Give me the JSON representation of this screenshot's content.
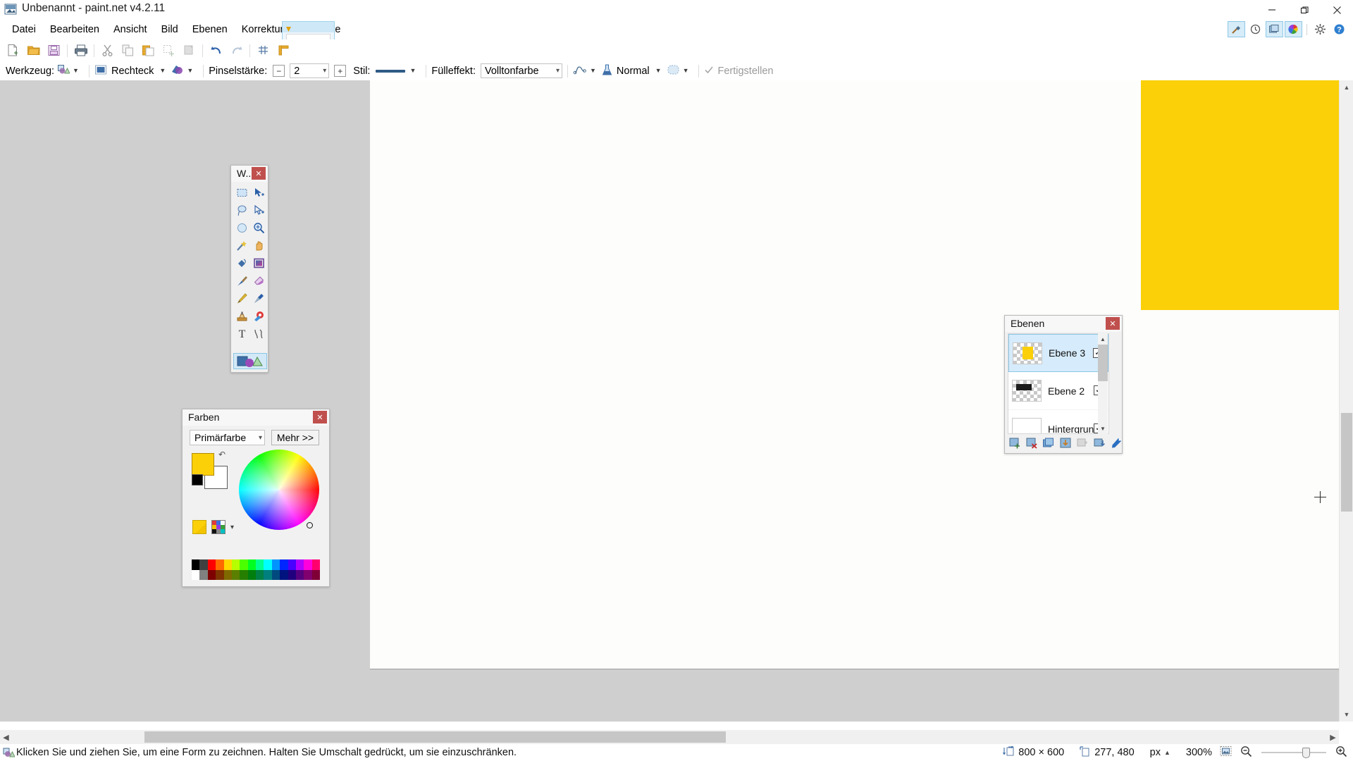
{
  "window": {
    "title": "Unbenannt - paint.net v4.2.11",
    "app_icon": "paintnet-app-icon",
    "controls": {
      "minimize": "minimize-icon",
      "restore": "restore-icon",
      "close": "close-icon"
    }
  },
  "menubar": {
    "items": [
      {
        "label": "Datei"
      },
      {
        "label": "Bearbeiten"
      },
      {
        "label": "Ansicht"
      },
      {
        "label": "Bild"
      },
      {
        "label": "Ebenen"
      },
      {
        "label": "Korrekturen"
      },
      {
        "label": "Effekte"
      }
    ]
  },
  "document_tab": {
    "title_hint": "Unbenannt",
    "thumbnail": "canvas-thumbnail"
  },
  "utility_bar": {
    "buttons": [
      {
        "name": "tools-window-toggle",
        "icon": "hammer-icon",
        "active": true
      },
      {
        "name": "history-window-toggle",
        "icon": "clock-history-icon",
        "active": false
      },
      {
        "name": "layers-window-toggle",
        "icon": "layers-stack-icon",
        "active": true
      },
      {
        "name": "colors-window-toggle",
        "icon": "color-wheel-icon",
        "active": true
      },
      {
        "name": "settings-button",
        "icon": "gear-icon",
        "active": false
      },
      {
        "name": "help-button",
        "icon": "question-circle-icon",
        "active": false
      }
    ]
  },
  "main_toolbar": {
    "buttons": [
      {
        "name": "new-button",
        "icon": "new-document-icon"
      },
      {
        "name": "open-button",
        "icon": "open-folder-icon"
      },
      {
        "name": "save-button",
        "icon": "floppy-save-icon"
      },
      {
        "name": "print-button",
        "icon": "printer-icon"
      },
      {
        "name": "cut-button",
        "icon": "scissors-icon"
      },
      {
        "name": "copy-button",
        "icon": "copy-icon"
      },
      {
        "name": "paste-button",
        "icon": "paste-icon"
      },
      {
        "name": "crop-button",
        "icon": "crop-to-selection-icon"
      },
      {
        "name": "deselect-button",
        "icon": "deselect-icon"
      },
      {
        "name": "undo-button",
        "icon": "undo-arrow-icon"
      },
      {
        "name": "redo-button",
        "icon": "redo-arrow-icon"
      },
      {
        "name": "grid-button",
        "icon": "grid-icon"
      },
      {
        "name": "rulers-button",
        "icon": "ruler-icon"
      }
    ]
  },
  "options_bar": {
    "tool_label": "Werkzeug:",
    "tool_icon": "shapes-tool-icon",
    "shape_label": "Rechteck",
    "shape_icon": "rectangle-shape-icon",
    "shape_type_icon": "shape-type-icon",
    "brush_width_label": "Pinselstärke:",
    "brush_width_value": "2",
    "style_label": "Stil:",
    "style_icon": "line-style-icon",
    "fill_label": "Fülleffekt:",
    "fill_value": "Volltonfarbe",
    "antialias_icon": "antialiasing-icon",
    "blend_icon": "blend-flask-icon",
    "blend_value": "Normal",
    "shape_sample_icon": "shape-preview-icon",
    "finish_label": "Fertigstellen",
    "finish_icon": "checkmark-icon"
  },
  "tools_window": {
    "title": "W...",
    "close_icon": "close-icon",
    "tools": [
      {
        "name": "tool-rectangle-select",
        "icon": "rectangle-select-icon"
      },
      {
        "name": "tool-move-selected",
        "icon": "move-selected-icon"
      },
      {
        "name": "tool-lasso-select",
        "icon": "lasso-select-icon"
      },
      {
        "name": "tool-move-selection",
        "icon": "move-selection-icon"
      },
      {
        "name": "tool-ellipse-select",
        "icon": "ellipse-select-icon"
      },
      {
        "name": "tool-zoom",
        "icon": "magnifier-icon"
      },
      {
        "name": "tool-magic-wand",
        "icon": "magic-wand-icon"
      },
      {
        "name": "tool-pan",
        "icon": "hand-pan-icon"
      },
      {
        "name": "tool-paint-bucket",
        "icon": "paint-bucket-icon"
      },
      {
        "name": "tool-gradient",
        "icon": "gradient-icon"
      },
      {
        "name": "tool-paintbrush",
        "icon": "paintbrush-icon"
      },
      {
        "name": "tool-eraser",
        "icon": "eraser-icon"
      },
      {
        "name": "tool-pencil",
        "icon": "pencil-icon"
      },
      {
        "name": "tool-color-picker",
        "icon": "eyedropper-icon"
      },
      {
        "name": "tool-clone-stamp",
        "icon": "clone-stamp-icon"
      },
      {
        "name": "tool-recolor",
        "icon": "recolor-icon"
      },
      {
        "name": "tool-text",
        "icon": "text-t-icon"
      },
      {
        "name": "tool-line-curve",
        "icon": "line-curve-icon"
      }
    ],
    "selected_tool": {
      "name": "tool-shapes",
      "icon": "shapes-icon"
    }
  },
  "colors_window": {
    "title": "Farben",
    "close_icon": "close-icon",
    "mode_value": "Primärfarbe",
    "more_label": "Mehr >>",
    "primary_color": "#fbd009",
    "secondary_color": "#ffffff",
    "reset_color": "#000000",
    "swap_icon": "swap-colors-icon",
    "add_palette_icon": "add-to-palette-icon",
    "palette_menu_icon": "palette-picker-icon",
    "palette_row1": [
      "#000000",
      "#404040",
      "#ff0000",
      "#ff6a00",
      "#ffd800",
      "#b6ff00",
      "#4cff00",
      "#00ff21",
      "#00ff90",
      "#00ffff",
      "#0094ff",
      "#0026ff",
      "#4800ff",
      "#b200ff",
      "#ff00dc",
      "#ff006e"
    ],
    "palette_row2": [
      "#ffffff",
      "#808080",
      "#7f0000",
      "#7f3300",
      "#7f6a00",
      "#5b7f00",
      "#267f00",
      "#007f0e",
      "#007f46",
      "#007f7f",
      "#004a7f",
      "#00137f",
      "#21007f",
      "#57007f",
      "#7f006e",
      "#7f0037"
    ]
  },
  "layers_window": {
    "title": "Ebenen",
    "close_icon": "close-icon",
    "layers": [
      {
        "name": "Ebene 3",
        "visible": true,
        "selected": true,
        "thumb": "yellow-rect-thumb"
      },
      {
        "name": "Ebene 2",
        "visible": true,
        "selected": false,
        "thumb": "black-rect-thumb"
      },
      {
        "name": "Hintergrund",
        "visible": true,
        "selected": false,
        "thumb": "white-bg-thumb"
      }
    ],
    "toolbar": [
      {
        "name": "add-layer-button",
        "icon": "add-layer-icon"
      },
      {
        "name": "delete-layer-button",
        "icon": "delete-layer-icon"
      },
      {
        "name": "duplicate-layer-button",
        "icon": "duplicate-layer-icon"
      },
      {
        "name": "merge-layer-down-button",
        "icon": "merge-down-icon"
      },
      {
        "name": "move-layer-up-button",
        "icon": "move-layer-up-icon"
      },
      {
        "name": "move-layer-down-button",
        "icon": "move-layer-down-icon"
      },
      {
        "name": "layer-properties-button",
        "icon": "wrench-icon"
      }
    ]
  },
  "canvas": {
    "shape_color": "#fbd009",
    "background": "#fdfdfb",
    "cursor_icon": "crosshair-cursor"
  },
  "statusbar": {
    "hint_icon": "shapes-tool-icon",
    "hint": "Klicken Sie und ziehen Sie, um eine Form zu zeichnen. Halten Sie Umschalt gedrückt, um sie einzuschränken.",
    "image_size_icon": "image-size-icon",
    "image_size": "800 × 600",
    "cursor_pos_icon": "cursor-position-icon",
    "cursor_pos": "277, 480",
    "unit": "px",
    "unit_caret_icon": "caret-up-icon",
    "zoom_level": "300%",
    "fit_icon": "fit-to-window-icon",
    "zoom_out_icon": "zoom-out-icon",
    "zoom_in_icon": "zoom-in-icon"
  },
  "scrollbars": {
    "vertical": {
      "up_icon": "chevron-up-icon",
      "down_icon": "chevron-down-icon"
    },
    "horizontal": {
      "left_icon": "chevron-left-icon",
      "right_icon": "chevron-right-icon"
    }
  }
}
